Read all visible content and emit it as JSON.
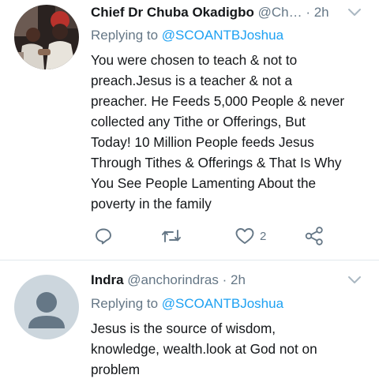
{
  "tweets": [
    {
      "name": "Chief Dr Chuba Okadigbo",
      "handle": "@Ch…",
      "separator": "·",
      "time": "2h",
      "replying_prefix": "Replying to",
      "replying_to": "@SCOANTBJoshua",
      "lines": [
        "You were chosen to teach & not to",
        "preach.Jesus is a teacher & not a",
        "preacher. He Feeds 5,000 People & never",
        "collected any Tithe or Offerings, But",
        "Today! 10 Million People feeds Jesus",
        "Through Tithes & Offerings & That Is Why",
        "You See People Lamenting About the",
        "poverty in the family"
      ],
      "actions": {
        "reply_icon": "reply-icon",
        "retweet_icon": "retweet-icon",
        "like_icon": "heart-icon",
        "like_count": "2",
        "share_icon": "share-icon"
      }
    },
    {
      "name": "Indra",
      "handle": "@anchorindras",
      "separator": "·",
      "time": "2h",
      "replying_prefix": "Replying to",
      "replying_to": "@SCOANTBJoshua",
      "lines": [
        "Jesus is the source of wisdom,",
        "knowledge, wealth.look at God not on",
        "problem"
      ]
    }
  ],
  "colors": {
    "text": "#14171a",
    "secondary": "#657786",
    "link": "#1da1f2",
    "divider": "#e1e8ed",
    "default_avatar_bg": "#ccd6dd",
    "default_avatar_fg": "#657786"
  }
}
